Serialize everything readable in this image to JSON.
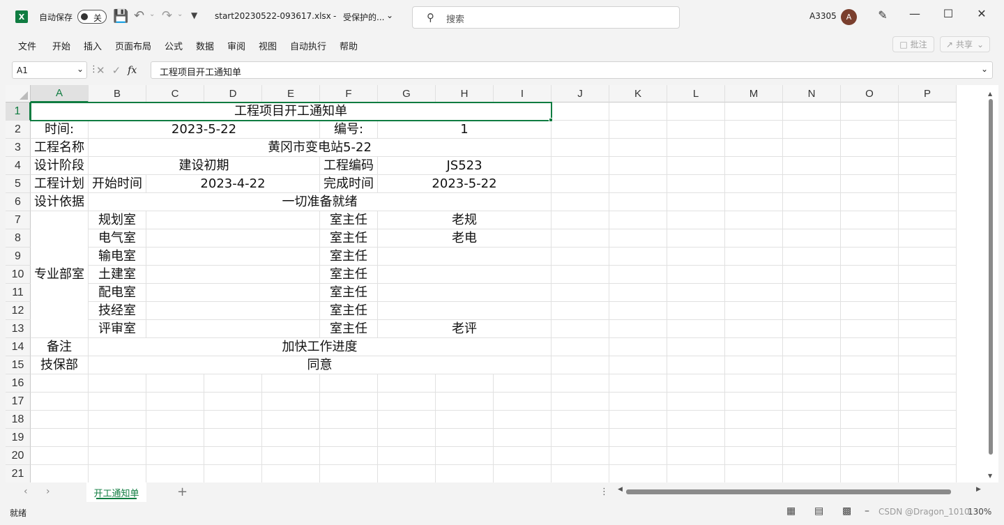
{
  "titlebar": {
    "app_letter": "X",
    "autosave_label": "自动保存",
    "autosave_state": "关",
    "filename": "start20230522-093617.xlsx",
    "protected_label": "受保护的...",
    "search_placeholder": "搜索",
    "user_id": "A3305",
    "avatar_letter": "A"
  },
  "menu": [
    "文件",
    "开始",
    "插入",
    "页面布局",
    "公式",
    "数据",
    "审阅",
    "视图",
    "自动执行",
    "帮助"
  ],
  "ribbon_right": {
    "comment": "批注",
    "share": "共享"
  },
  "formula_bar": {
    "name_box": "A1",
    "fx": "fx",
    "content": "工程项目开工通知单"
  },
  "columns": [
    "A",
    "B",
    "C",
    "D",
    "E",
    "F",
    "G",
    "H",
    "I",
    "J",
    "K",
    "L",
    "M",
    "N",
    "O",
    "P"
  ],
  "rows": [
    "1",
    "2",
    "3",
    "4",
    "5",
    "6",
    "7",
    "8",
    "9",
    "10",
    "11",
    "12",
    "13",
    "14",
    "15",
    "16",
    "17",
    "18",
    "19",
    "20",
    "21"
  ],
  "cells": {
    "title": "工程项目开工通知单",
    "time_label": "时间:",
    "time_value": "2023-5-22",
    "number_label": "编号:",
    "number_value": "1",
    "project_name_label": "工程名称",
    "project_name_value": "黄冈市变电站5-22",
    "design_stage_label": "设计阶段",
    "design_stage_value": "建设初期",
    "project_code_label": "工程编码",
    "project_code_value": "JS523",
    "plan_label": "工程计划",
    "start_label": "开始时间",
    "start_value": "2023-4-22",
    "finish_label": "完成时间",
    "finish_value": "2023-5-22",
    "basis_label": "设计依据",
    "basis_value": "一切准备就绪",
    "dept_label": "专业部室",
    "depts": [
      {
        "name": "规划室",
        "role": "室主任",
        "person": "老规"
      },
      {
        "name": "电气室",
        "role": "室主任",
        "person": "老电"
      },
      {
        "name": "输电室",
        "role": "室主任",
        "person": ""
      },
      {
        "name": "土建室",
        "role": "室主任",
        "person": ""
      },
      {
        "name": "配电室",
        "role": "室主任",
        "person": ""
      },
      {
        "name": "技经室",
        "role": "室主任",
        "person": ""
      },
      {
        "name": "评审室",
        "role": "室主任",
        "person": "老评"
      }
    ],
    "remark_label": "备注",
    "remark_value": "加快工作进度",
    "tech_label": "技保部",
    "tech_value": "同意"
  },
  "sheet_tab": "开工通知单",
  "status": {
    "ready": "就绪",
    "zoom": "130%",
    "watermark": "CSDN @Dragon_1010"
  }
}
